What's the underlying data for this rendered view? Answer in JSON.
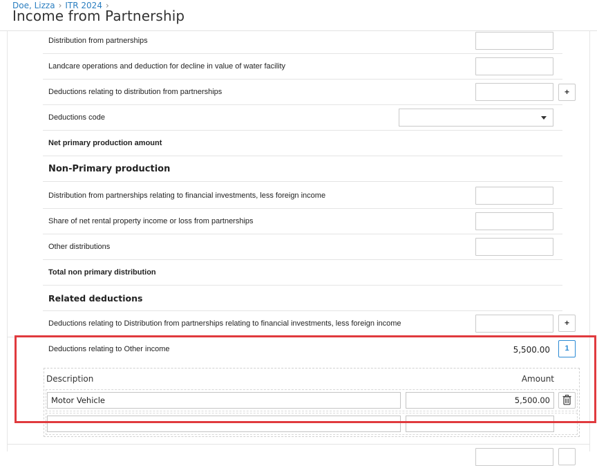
{
  "breadcrumb": {
    "client": "Doe, Lizza",
    "return": "ITR 2024"
  },
  "page": {
    "title": "Income from Partnership"
  },
  "rows": {
    "dist_partnerships": "Distribution from partnerships",
    "landcare": "Landcare operations and deduction for decline in value of water facility",
    "deductions_dist": "Deductions relating to distribution from partnerships",
    "deductions_code": "Deductions code",
    "net_primary": "Net primary production amount",
    "non_primary_heading": "Non-Primary production",
    "dist_financial": "Distribution from partnerships relating to financial investments, less foreign income",
    "rental_share": "Share of net rental property income or loss from partnerships",
    "other_dist": "Other distributions",
    "total_non_primary": "Total non primary distribution",
    "related_heading": "Related deductions",
    "deductions_financial": "Deductions relating to Distribution from partnerships relating to financial investments, less foreign income",
    "deductions_other": "Deductions relating to Other income"
  },
  "other_income": {
    "total": "5,500.00",
    "count": "1",
    "columns": {
      "description": "Description",
      "amount": "Amount"
    },
    "items": [
      {
        "description": "Motor Vehicle",
        "amount": "5,500.00"
      }
    ]
  },
  "buttons": {
    "plus": "+"
  },
  "colors": {
    "link": "#2a7ec0",
    "accent": "#2a8ad4",
    "highlight": "#e03a3e"
  },
  "icons": {
    "caret": "chevron-down-icon",
    "trash": "trash-icon"
  }
}
